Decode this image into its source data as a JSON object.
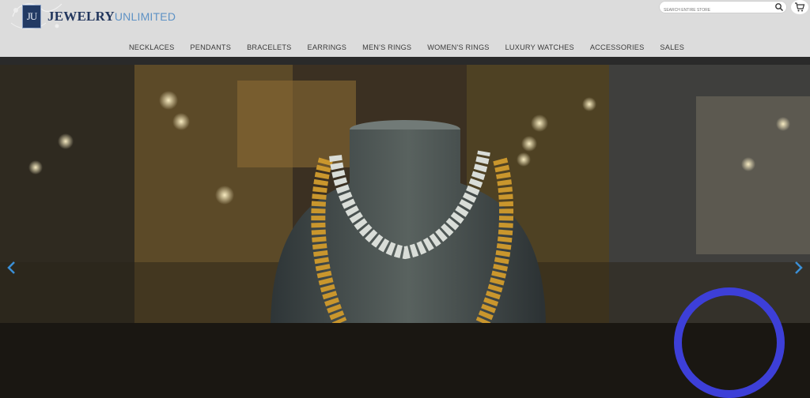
{
  "brand": {
    "logo_mark": "JU",
    "name_part1": "JEWELRY",
    "name_part2": "UNLIMITED"
  },
  "search": {
    "placeholder": "SEARCH ENTIRE STORE"
  },
  "nav": {
    "items": [
      "NECKLACES",
      "PENDANTS",
      "BRACELETS",
      "EARRINGS",
      "MEN'S RINGS",
      "WOMEN'S RINGS",
      "LUXURY WATCHES",
      "ACCESSORIES",
      "SALES"
    ]
  },
  "hero": {
    "image": "necklace-display",
    "prev_icon": "chevron-left-icon",
    "next_icon": "chevron-right-icon"
  },
  "colors": {
    "header_bg": "#dcdcdc",
    "brand_navy": "#22365d",
    "brand_blue": "#5e92c5",
    "arrow": "#3b8fd6",
    "badge_ring": "#3d3fd8"
  }
}
